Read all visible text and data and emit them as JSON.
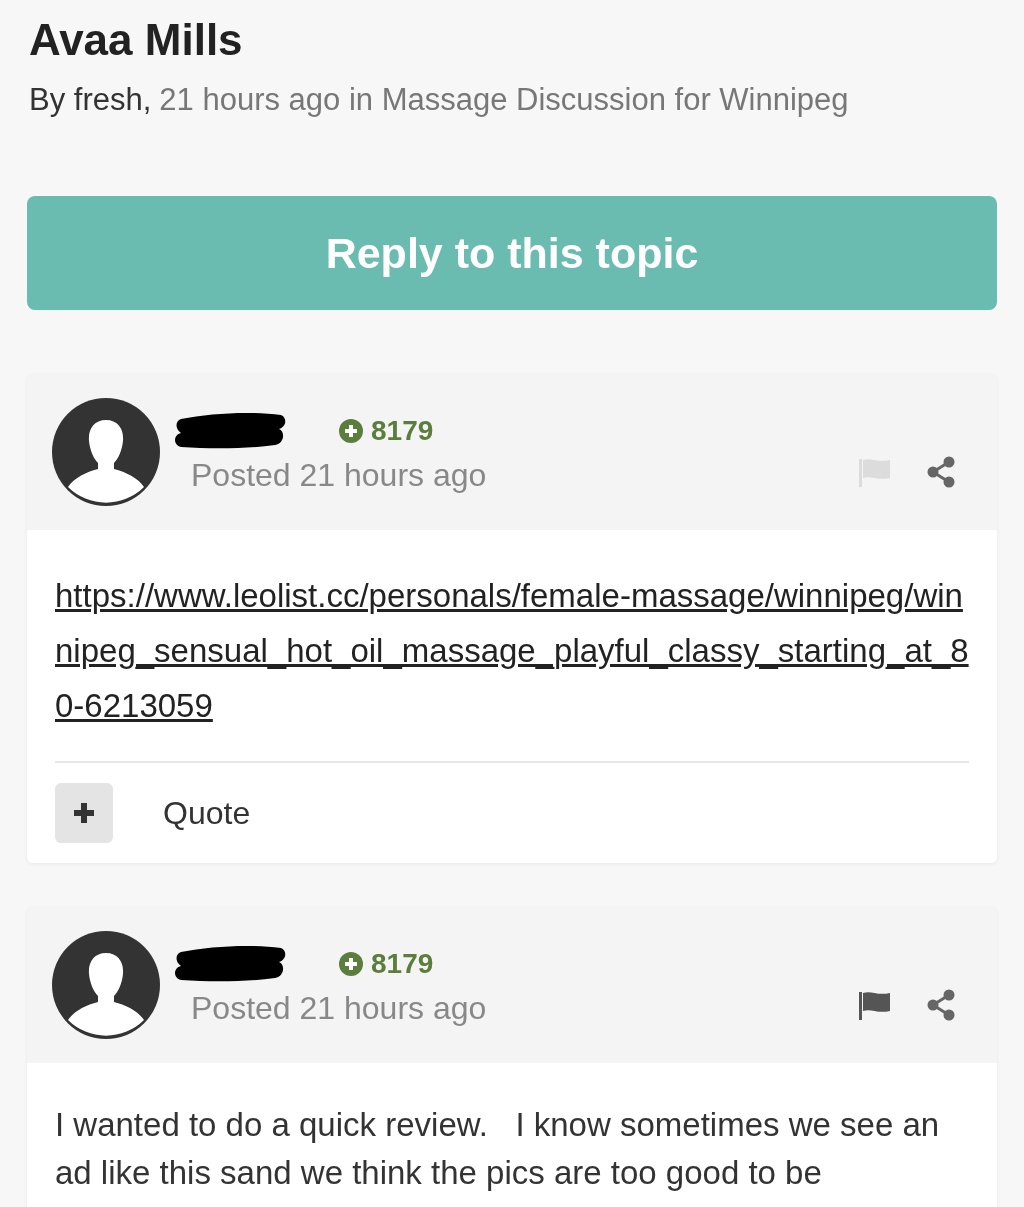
{
  "topic": {
    "title": "Avaa Mills",
    "author_prefix": "By fresh,",
    "meta": "21 hours ago in Massage Discussion for Winnipeg"
  },
  "reply_button": "Reply to this topic",
  "posts": [
    {
      "reputation": "8179",
      "posted": "Posted 21 hours ago",
      "report_disabled": true,
      "kind": "link",
      "content": "https://www.leolist.cc/personals/female-massage/winnipeg/winnipeg_sensual_hot_oil_massage_playful_classy_starting_at_80-6213059",
      "quote": "Quote"
    },
    {
      "reputation": "8179",
      "posted": "Posted 21 hours ago",
      "report_disabled": false,
      "kind": "text",
      "content": "I wanted to do a quick review.   I know sometimes we see an ad like this sand we think the pics are too good to be"
    }
  ]
}
